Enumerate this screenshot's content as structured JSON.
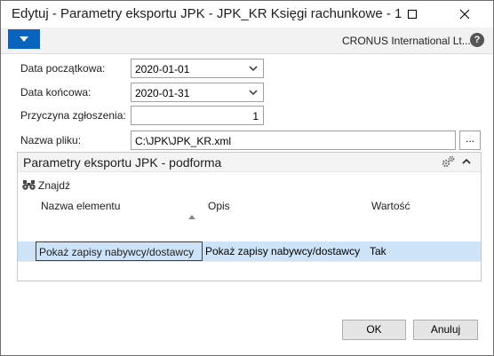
{
  "window": {
    "title": "Edytuj - Parametry eksportu JPK - JPK_KR Księgi rachunkowe - 1"
  },
  "ribbon": {
    "company": "CRONUS International Lt...",
    "help_label": "?"
  },
  "form": {
    "start_date": {
      "label": "Data początkowa:",
      "value": "2020-01-01"
    },
    "end_date": {
      "label": "Data końcowa:",
      "value": "2020-01-31"
    },
    "reason": {
      "label": "Przyczyna zgłoszenia:",
      "value": "1"
    },
    "file_name": {
      "label": "Nazwa pliku:",
      "value": "C:\\JPK\\JPK_KR.xml",
      "browse_label": "..."
    }
  },
  "subform": {
    "title": "Parametry eksportu JPK - podforma",
    "find_label": "Znajdź",
    "columns": [
      "Nazwa elementu",
      "Opis",
      "Wartość"
    ],
    "rows": [
      {
        "name": "Pokaż zapisy nabywcy/dostawcy",
        "description": "Pokaż zapisy nabywcy/dostawcy",
        "value": "Tak"
      }
    ]
  },
  "buttons": {
    "ok": "OK",
    "cancel": "Anuluj"
  },
  "colors": {
    "accent": "#0a64be",
    "row_selected": "#cde3f7"
  },
  "icons": [
    "maximize-icon",
    "close-icon",
    "dropdown-arrow-icon",
    "help-icon",
    "chevron-down-icon",
    "gears-icon",
    "chevron-up-icon",
    "binoculars-icon",
    "sort-ascending-icon"
  ]
}
